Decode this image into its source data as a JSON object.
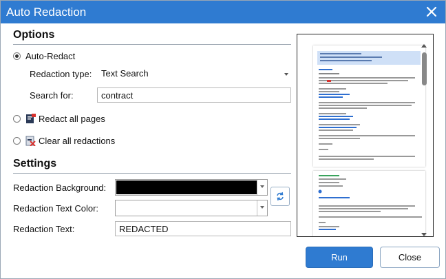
{
  "window": {
    "title": "Auto Redaction"
  },
  "options": {
    "heading": "Options",
    "auto_redact_label": "Auto-Redact",
    "auto_redact_selected": true,
    "redaction_type_label": "Redaction type:",
    "redaction_type_value": "Text Search",
    "search_for_label": "Search for:",
    "search_for_value": "contract",
    "redact_all_pages_label": "Redact all pages",
    "clear_all_redactions_label": "Clear all redactions"
  },
  "settings": {
    "heading": "Settings",
    "background_label": "Redaction Background:",
    "background_color": "#000000",
    "text_color_label": "Redaction Text Color:",
    "text_color": "#ffffff",
    "text_label": "Redaction Text:",
    "text_value": "REDACTED"
  },
  "buttons": {
    "run": "Run",
    "close": "Close"
  },
  "colors": {
    "accent": "#2f7bd1"
  },
  "icons": {
    "close": "close-icon",
    "redact_pages": "redact-pages-icon",
    "clear_redactions": "clear-redactions-icon",
    "swap": "swap-colors-icon"
  }
}
